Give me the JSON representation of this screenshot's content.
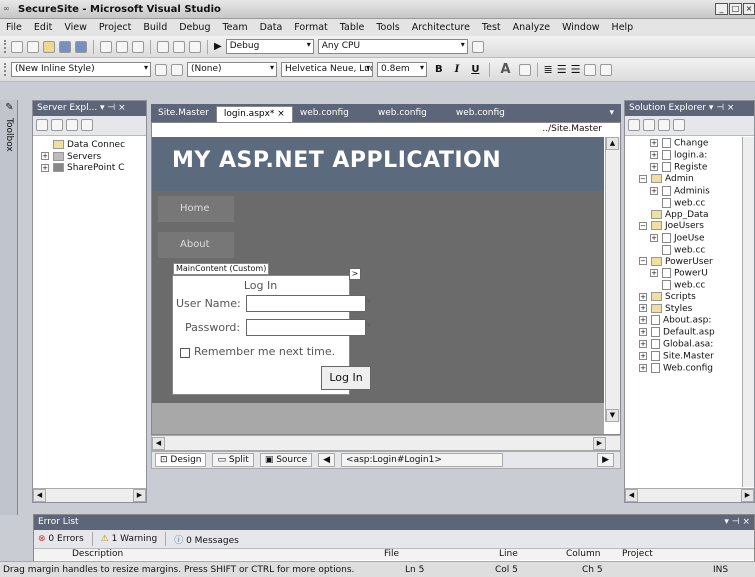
{
  "window": {
    "title": "SecureSite - Microsoft Visual Studio",
    "min": "_",
    "max": "□",
    "close": "×"
  },
  "menu": [
    "File",
    "Edit",
    "View",
    "Project",
    "Build",
    "Debug",
    "Team",
    "Data",
    "Format",
    "Table",
    "Tools",
    "Architecture",
    "Test",
    "Analyze",
    "Window",
    "Help"
  ],
  "toolbar1": {
    "config": "Debug",
    "platform": "Any CPU"
  },
  "toolbar2": {
    "style": "(New Inline Style)",
    "block": "(None)",
    "font": "Helvetica Neue, Luc",
    "size": "0.8em",
    "bold": "B",
    "italic": "I",
    "underline": "U",
    "fontcolor": "A"
  },
  "left_strip": {
    "toolbox": "Toolbox"
  },
  "server_explorer": {
    "title": "Server Expl...  ▾ ⊣ ×",
    "items": [
      {
        "label": "Data Connec",
        "expander": ""
      },
      {
        "label": "Servers",
        "expander": "+"
      },
      {
        "label": "SharePoint C",
        "expander": "+"
      }
    ]
  },
  "tabs": [
    {
      "label": "Site.Master"
    },
    {
      "label": "login.aspx*",
      "close": "×"
    },
    {
      "label": "web.config"
    },
    {
      "label": "web.config"
    },
    {
      "label": "web.config"
    }
  ],
  "tabs_dropdown": "▾",
  "designer": {
    "master_path": "../Site.Master",
    "app_title": "MY ASP.NET APPLICATION",
    "nav": [
      "Home",
      "About"
    ],
    "content_label": "MainContent (Custom)",
    "login": {
      "heading": "Log In",
      "username_label": "User Name:",
      "password_label": "Password:",
      "remember": "Remember me next time.",
      "button": "Log In",
      "required": "*",
      "smart_tag": ">"
    }
  },
  "viewbar": {
    "design": "Design",
    "split": "Split",
    "source": "Source",
    "tag": "<asp:Login#Login1>"
  },
  "solution_explorer": {
    "title": "Solution Explorer  ▾ ⊣ ×",
    "items": [
      {
        "label": "Change",
        "indent": 3,
        "expander": "+",
        "icon": "doc"
      },
      {
        "label": "login.a:",
        "indent": 3,
        "expander": "+",
        "icon": "doc"
      },
      {
        "label": "Registe",
        "indent": 3,
        "expander": "+",
        "icon": "doc"
      },
      {
        "label": "Admin",
        "indent": 2,
        "expander": "−",
        "icon": "folder"
      },
      {
        "label": "Adminis",
        "indent": 3,
        "expander": "+",
        "icon": "doc"
      },
      {
        "label": "web.cc",
        "indent": 3,
        "expander": "",
        "icon": "doc"
      },
      {
        "label": "App_Data",
        "indent": 2,
        "expander": "",
        "icon": "folder"
      },
      {
        "label": "JoeUsers",
        "indent": 2,
        "expander": "−",
        "icon": "folder"
      },
      {
        "label": "JoeUse",
        "indent": 3,
        "expander": "+",
        "icon": "doc"
      },
      {
        "label": "web.cc",
        "indent": 3,
        "expander": "",
        "icon": "doc"
      },
      {
        "label": "PowerUser",
        "indent": 2,
        "expander": "−",
        "icon": "folder"
      },
      {
        "label": "PowerU",
        "indent": 3,
        "expander": "+",
        "icon": "doc"
      },
      {
        "label": "web.cc",
        "indent": 3,
        "expander": "",
        "icon": "doc"
      },
      {
        "label": "Scripts",
        "indent": 2,
        "expander": "+",
        "icon": "folder"
      },
      {
        "label": "Styles",
        "indent": 2,
        "expander": "+",
        "icon": "folder"
      },
      {
        "label": "About.asp:",
        "indent": 2,
        "expander": "+",
        "icon": "doc"
      },
      {
        "label": "Default.asp",
        "indent": 2,
        "expander": "+",
        "icon": "doc"
      },
      {
        "label": "Global.asa:",
        "indent": 2,
        "expander": "+",
        "icon": "doc"
      },
      {
        "label": "Site.Master",
        "indent": 2,
        "expander": "+",
        "icon": "doc"
      },
      {
        "label": "Web.config",
        "indent": 2,
        "expander": "+",
        "icon": "doc"
      }
    ]
  },
  "error_list": {
    "title": "Error List",
    "errors": "0 Errors",
    "warnings": "1 Warning",
    "messages": "0 Messages",
    "columns": [
      "Description",
      "File",
      "Line",
      "Column",
      "Project"
    ]
  },
  "status": {
    "message": "Drag margin handles to resize margins. Press SHIFT or CTRL for more options.",
    "line": "Ln 5",
    "col": "Col 5",
    "ch": "Ch 5",
    "mode": "INS"
  }
}
